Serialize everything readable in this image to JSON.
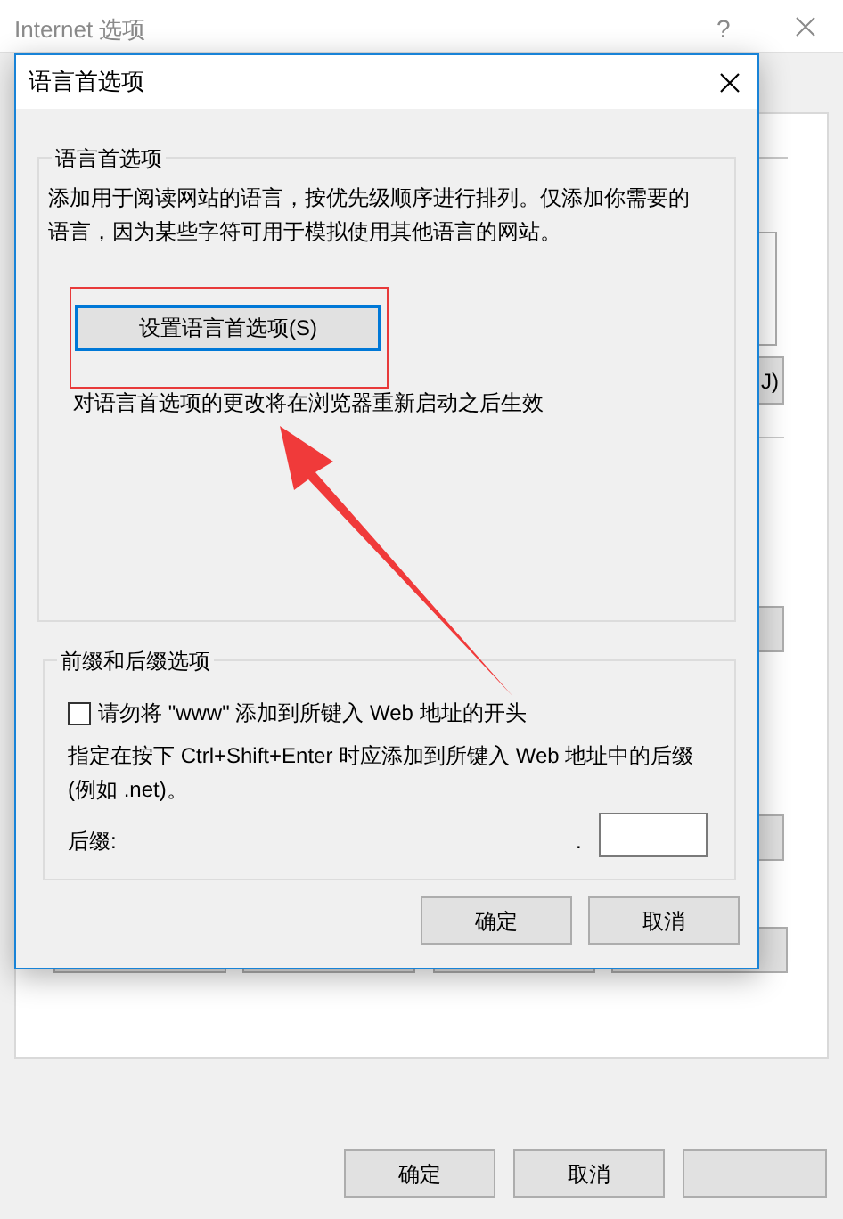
{
  "background_window": {
    "title": "Internet 选项",
    "help": "?",
    "partial_button": "J)",
    "buttons": [
      "确定",
      "取消"
    ]
  },
  "dialog": {
    "title": "语言首选项",
    "language_group": {
      "label": "语言首选项",
      "description": "添加用于阅读网站的语言，按优先级顺序进行排列。仅添加你需要的语言，因为某些字符可用于模拟使用其他语言的网站。",
      "button": "设置语言首选项(S)",
      "note": "对语言首选项的更改将在浏览器重新启动之后生效"
    },
    "affix_group": {
      "label": "前缀和后缀选项",
      "checkbox": {
        "label": "请勿将 \"www\" 添加到所键入 Web 地址的开头",
        "checked": false
      },
      "description": "指定在按下 Ctrl+Shift+Enter 时应添加到所键入 Web 地址中的后缀(例如 .net)。",
      "suffix_label": "后缀:",
      "dot": "."
    },
    "buttons": [
      "确定",
      "取消"
    ]
  }
}
